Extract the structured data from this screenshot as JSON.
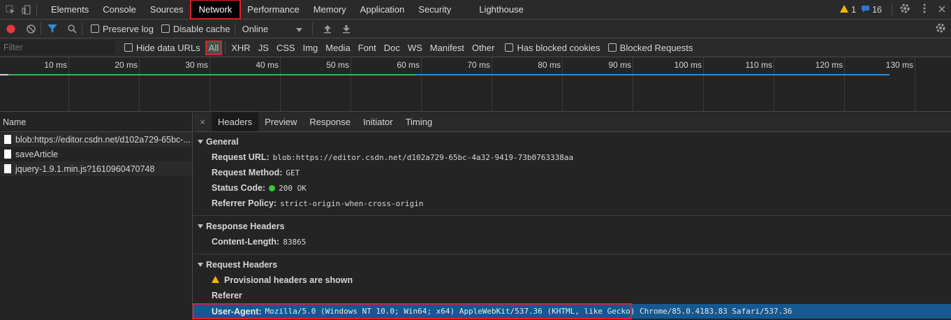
{
  "tabbar": {
    "tabs": [
      "Elements",
      "Console",
      "Sources",
      "Network",
      "Performance",
      "Memory",
      "Application",
      "Security",
      "Lighthouse"
    ],
    "active_tab": "Network",
    "warnings_count": "1",
    "messages_count": "16"
  },
  "toolbar1": {
    "preserve_log": "Preserve log",
    "disable_cache": "Disable cache",
    "throttling": "Online"
  },
  "toolbar2": {
    "filter_placeholder": "Filter",
    "hide_data_urls": "Hide data URLs",
    "types": [
      "All",
      "XHR",
      "JS",
      "CSS",
      "Img",
      "Media",
      "Font",
      "Doc",
      "WS",
      "Manifest",
      "Other"
    ],
    "has_blocked_cookies": "Has blocked cookies",
    "blocked_requests": "Blocked Requests"
  },
  "timeline": {
    "ticks": [
      "10 ms",
      "20 ms",
      "30 ms",
      "40 ms",
      "50 ms",
      "60 ms",
      "70 ms",
      "80 ms",
      "90 ms",
      "100 ms",
      "110 ms",
      "120 ms",
      "130 ms"
    ]
  },
  "requests": {
    "header": "Name",
    "items": [
      "blob:https://editor.csdn.net/d102a729-65bc-...",
      "saveArticle",
      "jquery-1.9.1.min.js?1610960470748"
    ]
  },
  "detail": {
    "tabs": [
      "Headers",
      "Preview",
      "Response",
      "Initiator",
      "Timing"
    ],
    "active_tab": "Headers",
    "close_glyph": "×",
    "general": {
      "title": "General",
      "request_url_label": "Request URL:",
      "request_url": "blob:https://editor.csdn.net/d102a729-65bc-4a32-9419-73b0763338aa",
      "request_method_label": "Request Method:",
      "request_method": "GET",
      "status_code_label": "Status Code:",
      "status_code": "200 OK",
      "referrer_policy_label": "Referrer Policy:",
      "referrer_policy": "strict-origin-when-cross-origin"
    },
    "response_headers": {
      "title": "Response Headers",
      "content_length_label": "Content-Length:",
      "content_length": "83865"
    },
    "request_headers": {
      "title": "Request Headers",
      "provisional": "Provisional headers are shown",
      "referer": "Referer",
      "user_agent_label": "User-Agent:",
      "user_agent": "Mozilla/5.0 (Windows NT 10.0; Win64; x64) AppleWebKit/537.36 (KHTML, like Gecko) Chrome/85.0.4183.83 Safari/537.36"
    }
  },
  "colors": {
    "accent_red": "#e0202a",
    "timeline_green": "#38b54a",
    "timeline_blue": "#2c8fd6",
    "selected_row": "#16588f"
  }
}
